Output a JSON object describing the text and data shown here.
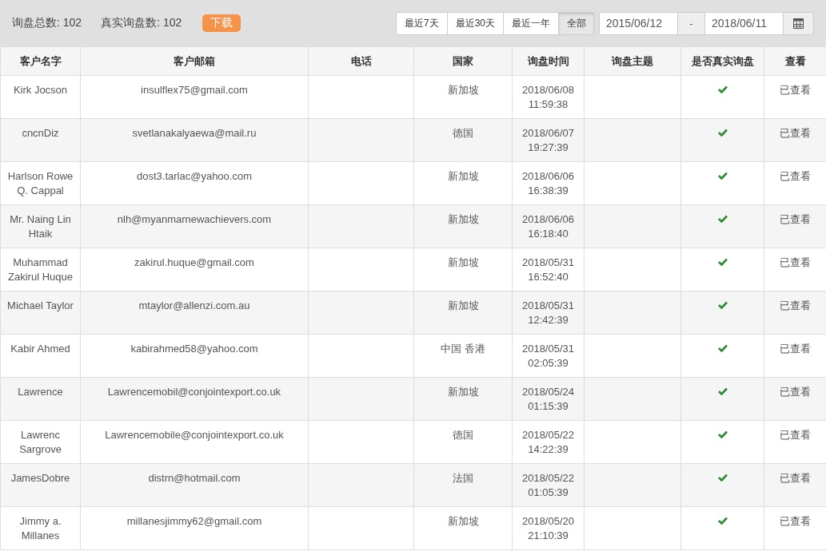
{
  "summary": [
    {
      "label": "询盘总数: 102"
    },
    {
      "label": "真实询盘数: 102"
    }
  ],
  "download_button": "下载",
  "ranges": [
    {
      "label": "最近7天",
      "selected": false
    },
    {
      "label": "最近30天",
      "selected": false
    },
    {
      "label": "最近一年",
      "selected": false
    },
    {
      "label": "全部",
      "selected": true
    }
  ],
  "date_from": "2015/06/12",
  "date_separator": "-",
  "date_to": "2018/06/11",
  "table": {
    "columns": [
      "客户名字",
      "客户邮箱",
      "电话",
      "国家",
      "询盘时间",
      "询盘主题",
      "是否真实询盘",
      "查看"
    ],
    "rows": [
      {
        "name": "Kirk Jocson",
        "email": "insulflex75@gmail.com",
        "country": "新加坡",
        "time": "2018/06/08 11:59:38",
        "real": true,
        "view": "已查看"
      },
      {
        "name": "cncnDiz",
        "email": "svetlanakalyaewa@mail.ru",
        "country": "德国",
        "time": "2018/06/07 19:27:39",
        "real": true,
        "view": "已查看"
      },
      {
        "name": "Harlson Rowe Q. Cappal",
        "email": "dost3.tarlac@yahoo.com",
        "country": "新加坡",
        "time": "2018/06/06 16:38:39",
        "real": true,
        "view": "已查看"
      },
      {
        "name": "Mr. Naing Lin Htaik",
        "email": "nlh@myanmarnewachievers.com",
        "country": "新加坡",
        "time": "2018/06/06 16:18:40",
        "real": true,
        "view": "已查看"
      },
      {
        "name": "Muhammad Zakirul Huque",
        "email": "zakirul.huque@gmail.com",
        "country": "新加坡",
        "time": "2018/05/31 16:52:40",
        "real": true,
        "view": "已查看"
      },
      {
        "name": "Michael Taylor",
        "email": "mtaylor@allenzi.com.au",
        "country": "新加坡",
        "time": "2018/05/31 12:42:39",
        "real": true,
        "view": "已查看"
      },
      {
        "name": "Kabir Ahmed",
        "email": "kabirahmed58@yahoo.com",
        "country": "中国 香港",
        "time": "2018/05/31 02:05:39",
        "real": true,
        "view": "已查看"
      },
      {
        "name": "Lawrence",
        "email": "Lawrencemobil@conjointexport.co.uk",
        "country": "新加坡",
        "time": "2018/05/24 01:15:39",
        "real": true,
        "view": "已查看"
      },
      {
        "name": "Lawrenc Sargrove",
        "email": "Lawrencemobile@conjointexport.co.uk",
        "country": "德国",
        "time": "2018/05/22 14:22:39",
        "real": true,
        "view": "已查看"
      },
      {
        "name": "JamesDobre",
        "email": "distrn@hotmail.com",
        "country": "法国",
        "time": "2018/05/22 01:05:39",
        "real": true,
        "view": "已查看"
      },
      {
        "name": "Jimmy a. Millanes",
        "email": "millanesjimmy62@gmail.com",
        "country": "新加坡",
        "time": "2018/05/20 21:10:39",
        "real": true,
        "view": "已查看"
      }
    ]
  }
}
